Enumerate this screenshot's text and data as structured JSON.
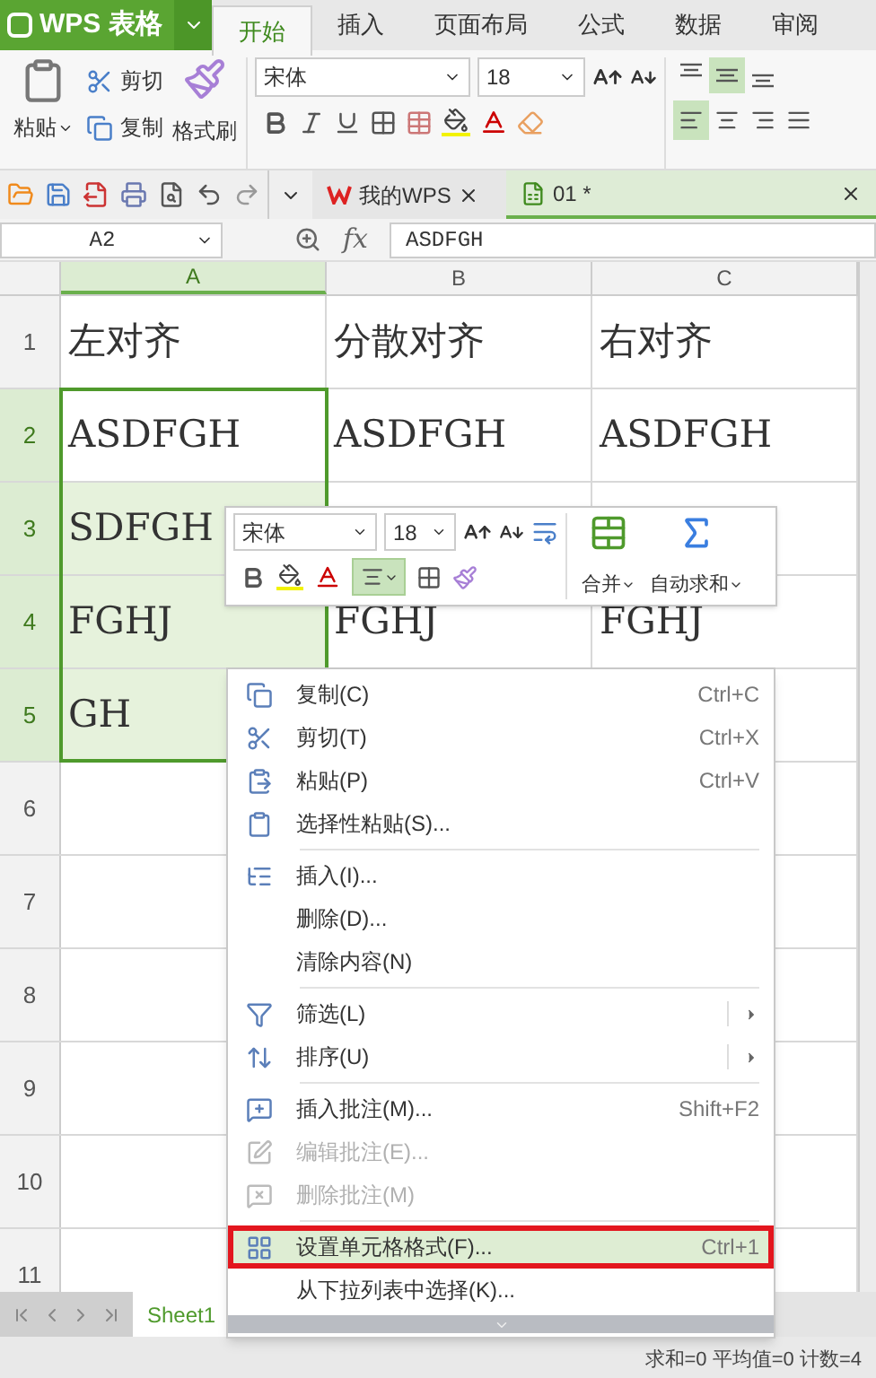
{
  "app_button": {
    "label": "WPS 表格"
  },
  "ribbon_tabs": [
    {
      "label": "开始",
      "selected": true
    },
    {
      "label": "插入",
      "selected": false
    },
    {
      "label": "页面布局",
      "selected": false
    },
    {
      "label": "公式",
      "selected": false
    },
    {
      "label": "数据",
      "selected": false
    },
    {
      "label": "审阅",
      "selected": false
    }
  ],
  "clipboard": {
    "paste": "粘贴",
    "cut": "剪切",
    "copy": "复制",
    "format_painter": "格式刷"
  },
  "font": {
    "name": "宋体",
    "size": "18"
  },
  "alignment": {
    "vertical": [
      {
        "selected": false
      },
      {
        "selected": true
      },
      {
        "selected": false
      }
    ],
    "horizontal": [
      {
        "selected": true
      },
      {
        "selected": false
      },
      {
        "selected": false
      },
      {
        "selected": false
      }
    ]
  },
  "documents": [
    {
      "label": "我的WPS",
      "selected": false
    },
    {
      "label": "01 *",
      "selected": true
    }
  ],
  "formula_bar": {
    "cell": "A2",
    "fx": "fx",
    "value": "ASDFGH"
  },
  "sheet": {
    "columns": [
      {
        "label": "A",
        "selected": true
      },
      {
        "label": "B",
        "selected": false
      },
      {
        "label": "C",
        "selected": false
      }
    ],
    "rows": [
      {
        "label": "1",
        "selected": false,
        "cells": [
          {
            "text": "左对齐",
            "selected": false
          },
          {
            "text": "分散对齐",
            "selected": false
          },
          {
            "text": "右对齐",
            "selected": false
          }
        ]
      },
      {
        "label": "2",
        "selected": true,
        "cells": [
          {
            "text": "ASDFGH",
            "selected": false
          },
          {
            "text": "ASDFGH",
            "selected": false
          },
          {
            "text": "ASDFGH",
            "selected": false
          }
        ]
      },
      {
        "label": "3",
        "selected": true,
        "cells": [
          {
            "text": "SDFGH",
            "selected": true
          }
        ]
      },
      {
        "label": "4",
        "selected": true,
        "cells": [
          {
            "text": "FGHJ",
            "selected": true
          },
          {
            "text": "FGHJ",
            "selected": false
          },
          {
            "text": "FGHJ",
            "selected": false
          }
        ]
      },
      {
        "label": "5",
        "selected": true,
        "cells": [
          {
            "text": "GH",
            "selected": true
          }
        ]
      },
      {
        "label": "6",
        "selected": false,
        "cells": []
      },
      {
        "label": "7",
        "selected": false,
        "cells": []
      },
      {
        "label": "8",
        "selected": false,
        "cells": []
      },
      {
        "label": "9",
        "selected": false,
        "cells": []
      },
      {
        "label": "10",
        "selected": false,
        "cells": []
      },
      {
        "label": "11",
        "selected": false,
        "cells": []
      }
    ]
  },
  "mini_toolbar": {
    "font": "宋体",
    "size": "18",
    "center_align_selected": true,
    "merge": "合并",
    "autosum": "自动求和"
  },
  "context_menu": [
    {
      "kind": "item",
      "label": "复制(C)",
      "shortcut": "Ctrl+C",
      "disabled": false,
      "highlighted": false,
      "submenu": false
    },
    {
      "kind": "item",
      "label": "剪切(T)",
      "shortcut": "Ctrl+X",
      "disabled": false,
      "highlighted": false,
      "submenu": false
    },
    {
      "kind": "item",
      "label": "粘贴(P)",
      "shortcut": "Ctrl+V",
      "disabled": false,
      "highlighted": false,
      "submenu": false
    },
    {
      "kind": "item",
      "label": "选择性粘贴(S)...",
      "disabled": false,
      "highlighted": false,
      "submenu": false
    },
    {
      "kind": "separator"
    },
    {
      "kind": "item",
      "label": "插入(I)...",
      "disabled": false,
      "highlighted": false,
      "submenu": false
    },
    {
      "kind": "item",
      "label": "删除(D)...",
      "disabled": false,
      "highlighted": false,
      "submenu": false
    },
    {
      "kind": "item",
      "label": "清除内容(N)",
      "disabled": false,
      "highlighted": false,
      "submenu": false
    },
    {
      "kind": "separator"
    },
    {
      "kind": "item",
      "label": "筛选(L)",
      "disabled": false,
      "highlighted": false,
      "submenu": true
    },
    {
      "kind": "item",
      "label": "排序(U)",
      "disabled": false,
      "highlighted": false,
      "submenu": true
    },
    {
      "kind": "separator"
    },
    {
      "kind": "item",
      "label": "插入批注(M)...",
      "shortcut": "Shift+F2",
      "disabled": false,
      "highlighted": false,
      "submenu": false
    },
    {
      "kind": "item",
      "label": "编辑批注(E)...",
      "disabled": true,
      "highlighted": false,
      "submenu": false
    },
    {
      "kind": "item",
      "label": "删除批注(M)",
      "disabled": true,
      "highlighted": false,
      "submenu": false
    },
    {
      "kind": "separator"
    },
    {
      "kind": "item",
      "label": "设置单元格格式(F)...",
      "shortcut": "Ctrl+1",
      "disabled": false,
      "highlighted": true,
      "submenu": false
    },
    {
      "kind": "item",
      "label": "从下拉列表中选择(K)...",
      "disabled": false,
      "highlighted": false,
      "submenu": false
    }
  ],
  "annotation": {
    "frames_highlighted_item": true
  },
  "sheet_tabs": [
    {
      "label": "Sheet1",
      "selected": true
    }
  ],
  "status_bar": {
    "text": "求和=0 平均值=0 计数=4"
  }
}
